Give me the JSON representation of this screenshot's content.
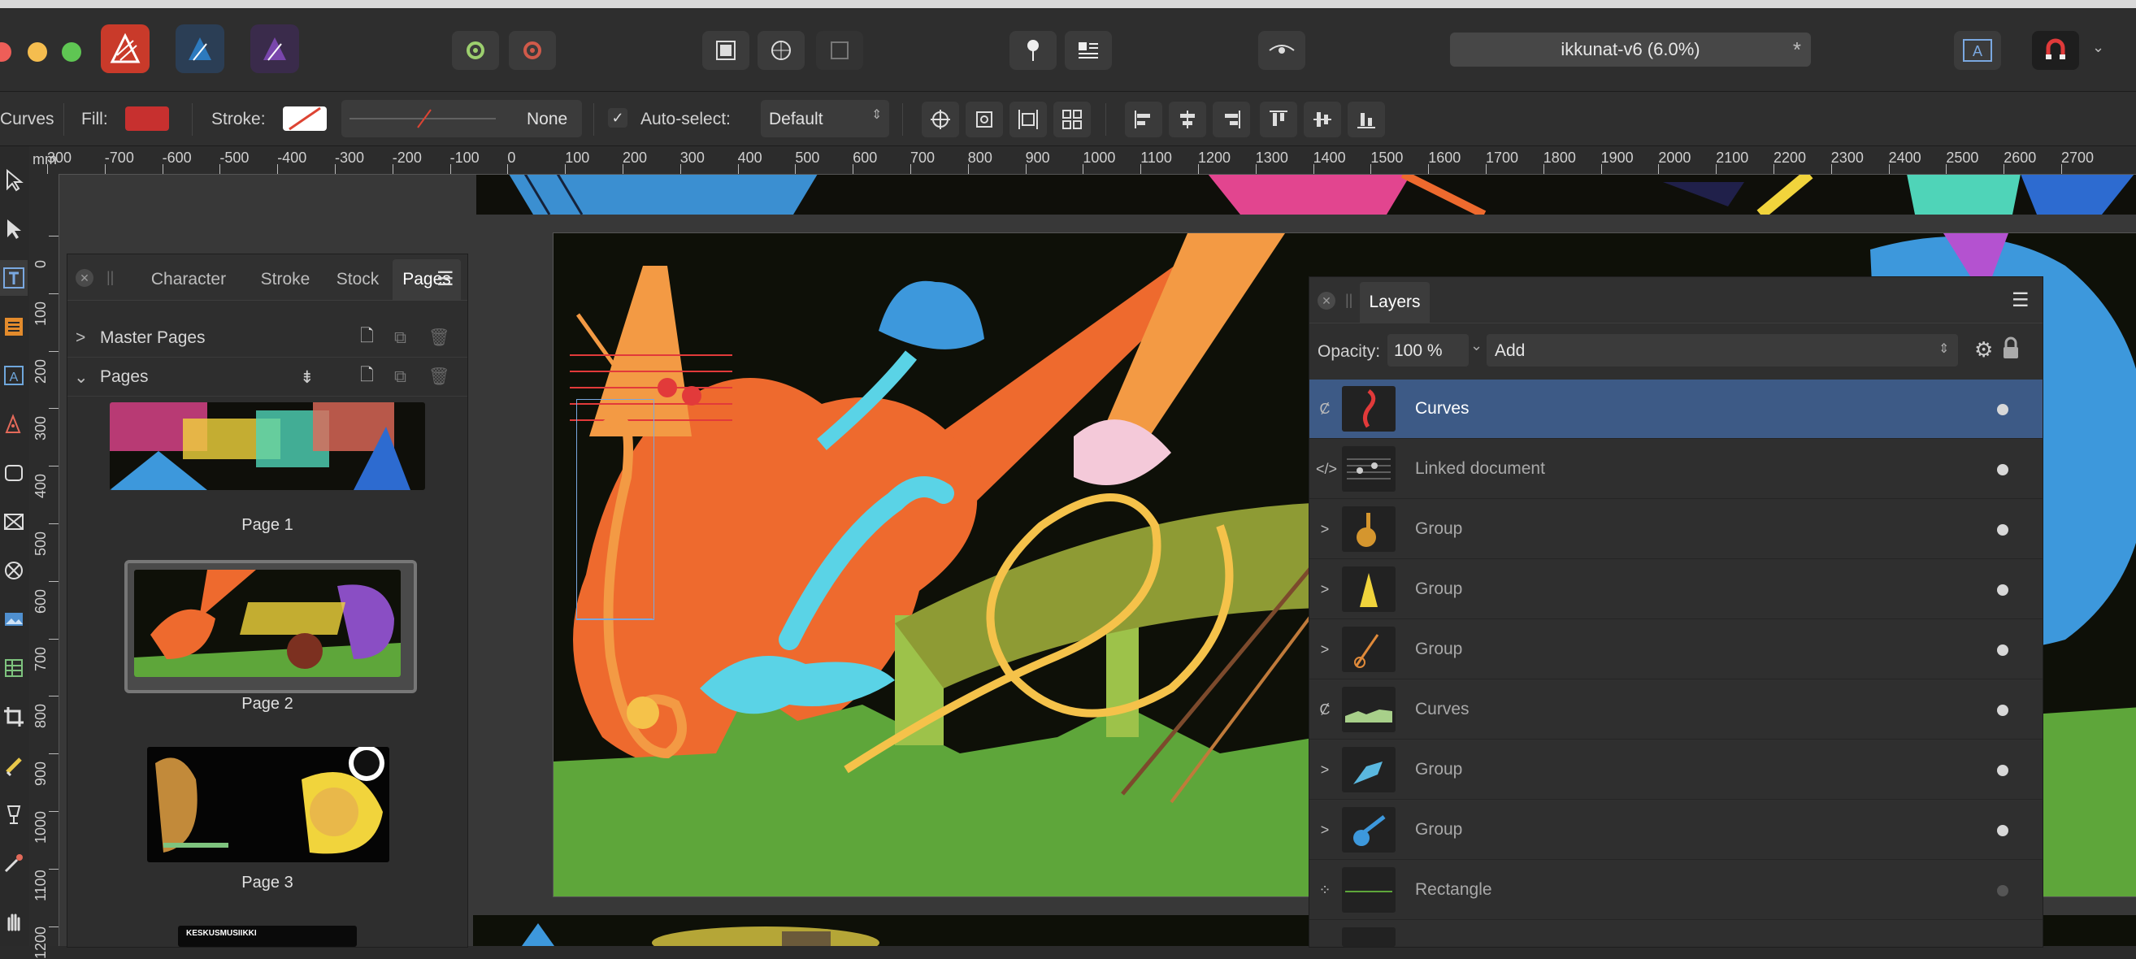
{
  "window": {
    "document_title": "ikkunat-v6 (6.0%)",
    "modified_mark": "*"
  },
  "context_toolbar": {
    "tool_name": "Curves",
    "fill_label": "Fill:",
    "fill_color": "#c7302f",
    "stroke_label": "Stroke:",
    "stroke_value": "None",
    "autoselect_label": "Auto-select:",
    "autoselect_value": "Default"
  },
  "ruler": {
    "unit": "mm",
    "h_labels": [
      "300",
      "-700",
      "-600",
      "-500",
      "-400",
      "-300",
      "-200",
      "-100",
      "0",
      "100",
      "200",
      "300",
      "400",
      "500",
      "600",
      "700",
      "800",
      "900",
      "1000",
      "1100",
      "1200",
      "1300",
      "1400",
      "1500",
      "1600",
      "1700",
      "1800",
      "1900",
      "2000",
      "2100",
      "2200",
      "2300",
      "2400",
      "2500",
      "2600",
      "2700"
    ],
    "v_labels": [
      "0",
      "100",
      "200",
      "300",
      "400",
      "500",
      "600",
      "700",
      "800",
      "900",
      "1000",
      "1100",
      "1200"
    ]
  },
  "pages_panel": {
    "tabs": [
      "Character",
      "Stroke",
      "Stock",
      "Pages"
    ],
    "active_tab": "Pages",
    "master_pages_label": "Master Pages",
    "pages_label": "Pages",
    "pages": [
      {
        "label": "Page 1"
      },
      {
        "label": "Page 2"
      },
      {
        "label": "Page 3"
      }
    ],
    "page4_caption": "KESKUSMUSIIKKI"
  },
  "layers_panel": {
    "title": "Layers",
    "opacity_label": "Opacity:",
    "opacity_value": "100 %",
    "blend_mode": "Add",
    "layers": [
      {
        "name": "Curves"
      },
      {
        "name": "Linked document"
      },
      {
        "name": "Group"
      },
      {
        "name": "Group"
      },
      {
        "name": "Group"
      },
      {
        "name": "Curves"
      },
      {
        "name": "Group"
      },
      {
        "name": "Group"
      },
      {
        "name": "Rectangle"
      }
    ]
  },
  "colors": {
    "selection": "#3d5a86",
    "accent_orange": "#ee6a2e",
    "accent_blue": "#3d98dc",
    "accent_green": "#5ea63a"
  }
}
